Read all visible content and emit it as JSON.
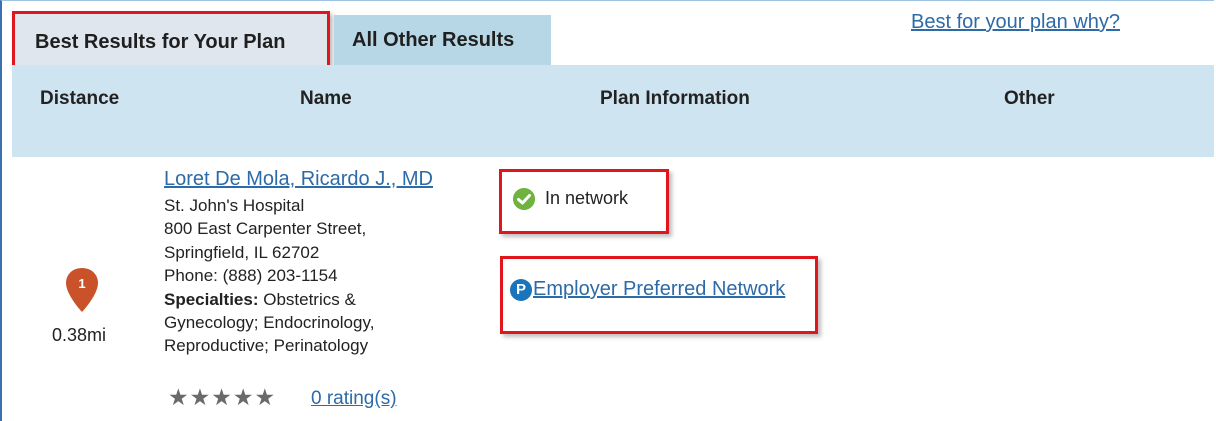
{
  "tabs": {
    "best": "Best Results for Your Plan",
    "other": "All Other Results"
  },
  "why_link": "Best for your plan why?",
  "columns": {
    "distance": "Distance",
    "name": "Name",
    "plan": "Plan Information",
    "other": "Other"
  },
  "result": {
    "provider_name": "Loret De Mola, Ricardo J., MD",
    "hospital": "St. John's Hospital",
    "address_line1": "800 East Carpenter Street,",
    "address_line2": "Springfield, IL 62702",
    "phone": "Phone: (888) 203-1154",
    "specialties_label": "Specialties:",
    "specialties_line1": " Obstetrics &",
    "specialties_line2": "Gynecology; Endocrinology,",
    "specialties_line3": "Reproductive; Perinatology",
    "marker_number": "1",
    "distance": "0.38mi",
    "stars": "★★★★★",
    "ratings": "0 rating(s)",
    "network_status": "In network",
    "p_icon": "P",
    "employer_network": "Employer Preferred Network"
  },
  "colors": {
    "highlight_red": "#e1151d",
    "link_blue": "#2c6aa8",
    "header_band": "#cfe4f1",
    "marker_orange": "#c9522b",
    "check_green": "#6fb23f"
  }
}
